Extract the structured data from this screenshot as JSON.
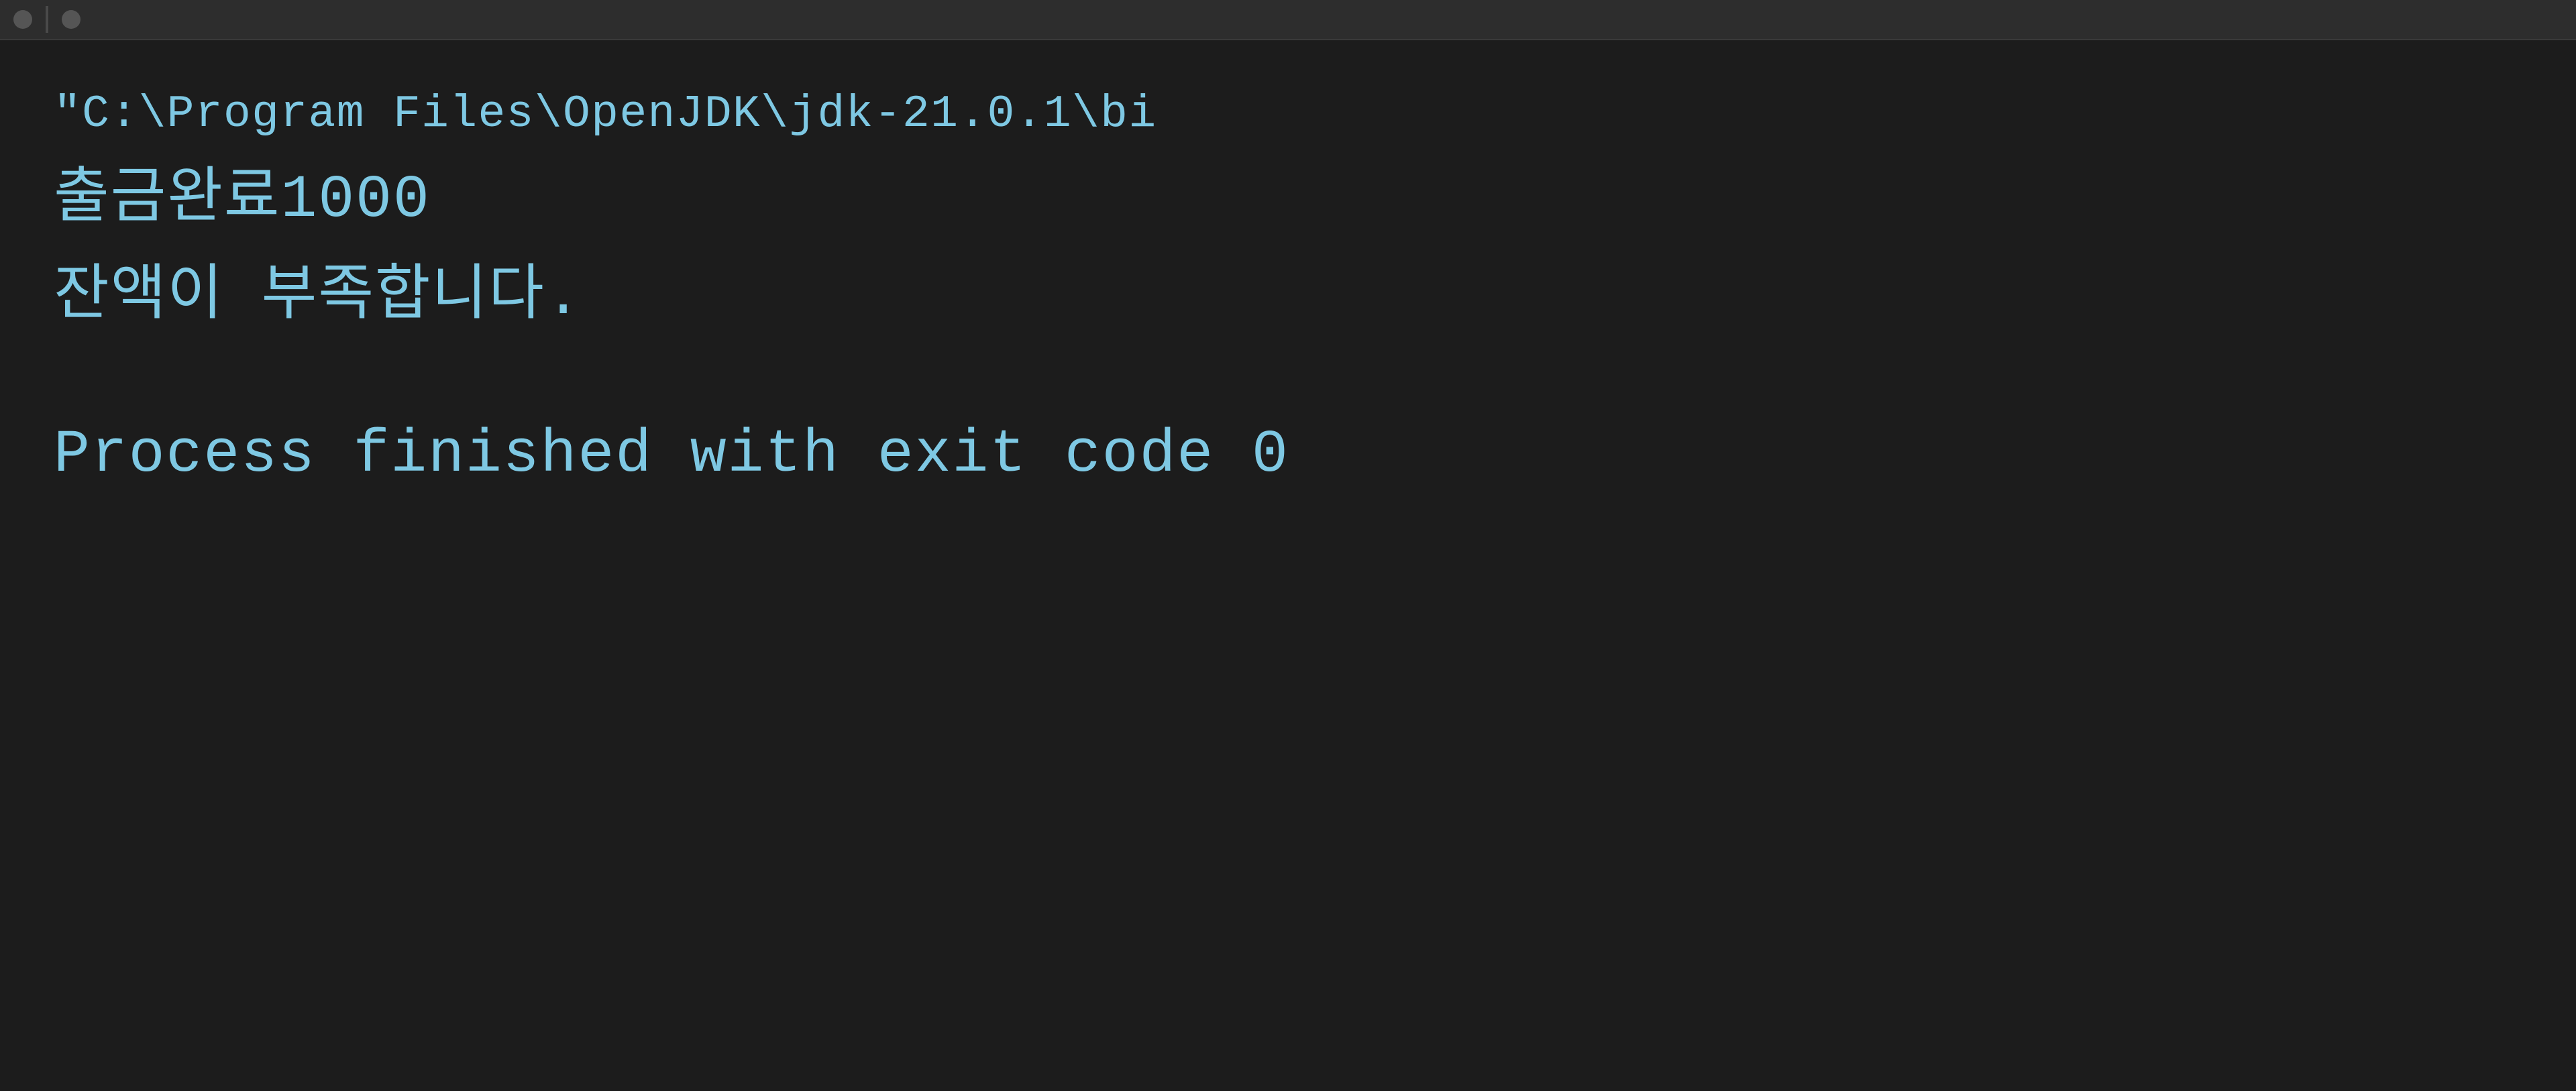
{
  "terminal": {
    "top_bar": {
      "dot1": "",
      "separator": "",
      "dot2": ""
    },
    "lines": {
      "command": "\"C:\\Program Files\\OpenJDK\\jdk-21.0.1\\bi",
      "output_line1": "출금완료1000",
      "output_line2": "잔액이 부족합니다.",
      "process_finished": "Process finished with exit code 0"
    }
  },
  "colors": {
    "bg": "#1c1c1c",
    "topbar_bg": "#2d2d2d",
    "text_cyan": "#7ec8e3"
  }
}
